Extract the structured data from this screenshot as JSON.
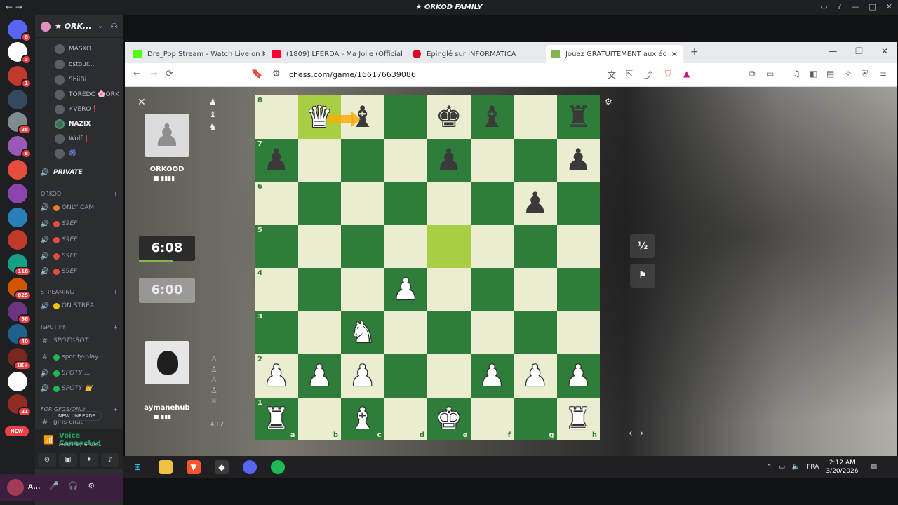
{
  "discord": {
    "title": "★ ORKOD FAMILY",
    "guild_name": "★ ORK...",
    "voice_users": [
      "MASKO",
      "ostour...",
      "ShiiBi",
      "TOREDO 🌸ORK",
      "⚡VERO❗",
      "NAZIX",
      "Wolf❗",
      "🎆"
    ],
    "private_channel": "PRIVATE",
    "categories": {
      "orkod": "Orkod",
      "streaming": "STREAMING",
      "spotify": "ISPOTIFY",
      "fun": "For gfgs/Only"
    },
    "channels": {
      "only_cam": "ONLY CAM",
      "s9ef_1": "S9EF",
      "s9ef_2": "S9EF",
      "s9ef_3": "S9EF",
      "s9ef_4": "S9EF",
      "on_stream": "ON STREA...",
      "spoty_bot": "SPOTY-BOT...",
      "spotify_play": "spotify-play...",
      "spoty_1": "SPOTY ...",
      "spoty_2": "SPOTY 👑",
      "girls_chat": "girls-chat"
    },
    "new_unreads": "NEW UNREADS",
    "new_badge": "NEW",
    "server_badges": [
      "8",
      "3",
      "1",
      "28",
      "8",
      "116",
      "825",
      "96",
      "40",
      "1K+",
      "21"
    ],
    "voice_connected": "Voice Connected",
    "voice_sub": "PRIVATE / ★ OR...",
    "user_name": "A..."
  },
  "browser": {
    "tabs": [
      {
        "label": "Dre_Pop Stream - Watch Live on Kick",
        "color": "#53fc18"
      },
      {
        "label": "(1809) LFERDA - Ma Jolie (Official Au",
        "color": "#ff0033"
      },
      {
        "label": "Épinglé sur INFORMÁTICA",
        "color": "#e60023"
      },
      {
        "label": "Jouez GRATUITEMENT aux éc",
        "color": "#81b64c"
      }
    ],
    "url": "chess.com/game/166176639086"
  },
  "chess": {
    "opponent": {
      "name": "ORKOOD",
      "clock": "6:00"
    },
    "player": {
      "name": "aymanehub",
      "clock": "6:08"
    },
    "captured_top": [
      "♟",
      "♝",
      "♞"
    ],
    "captured_bottom": [
      "♙",
      "♙",
      "♙",
      "♙",
      "♕"
    ],
    "material_diff": "+17",
    "draw_label": "½",
    "files": [
      "a",
      "b",
      "c",
      "d",
      "e",
      "f",
      "g",
      "h"
    ],
    "ranks": [
      "8",
      "7",
      "6",
      "5",
      "4",
      "3",
      "2",
      "1"
    ],
    "board": [
      [
        "",
        "wQ",
        "bB",
        "",
        "bK",
        "bB",
        "",
        "bR"
      ],
      [
        "bP",
        "",
        "",
        "",
        "bP",
        "",
        "",
        "bP"
      ],
      [
        "",
        "",
        "",
        "",
        "",
        "",
        "bP",
        ""
      ],
      [
        "",
        "",
        "",
        "",
        "",
        "",
        "",
        ""
      ],
      [
        "",
        "",
        "",
        "wP",
        "",
        "",
        "",
        ""
      ],
      [
        "",
        "",
        "wN",
        "",
        "",
        "",
        "",
        ""
      ],
      [
        "wP",
        "wP",
        "wP",
        "",
        "",
        "wP",
        "wP",
        "wP"
      ],
      [
        "wR",
        "",
        "wB",
        "",
        "wK",
        "",
        "",
        "wR"
      ]
    ],
    "highlight_squares": [
      "b8",
      "e5"
    ]
  },
  "taskbar": {
    "lang": "FRA",
    "time": "2:12 AM",
    "date": "3/20/2026"
  }
}
